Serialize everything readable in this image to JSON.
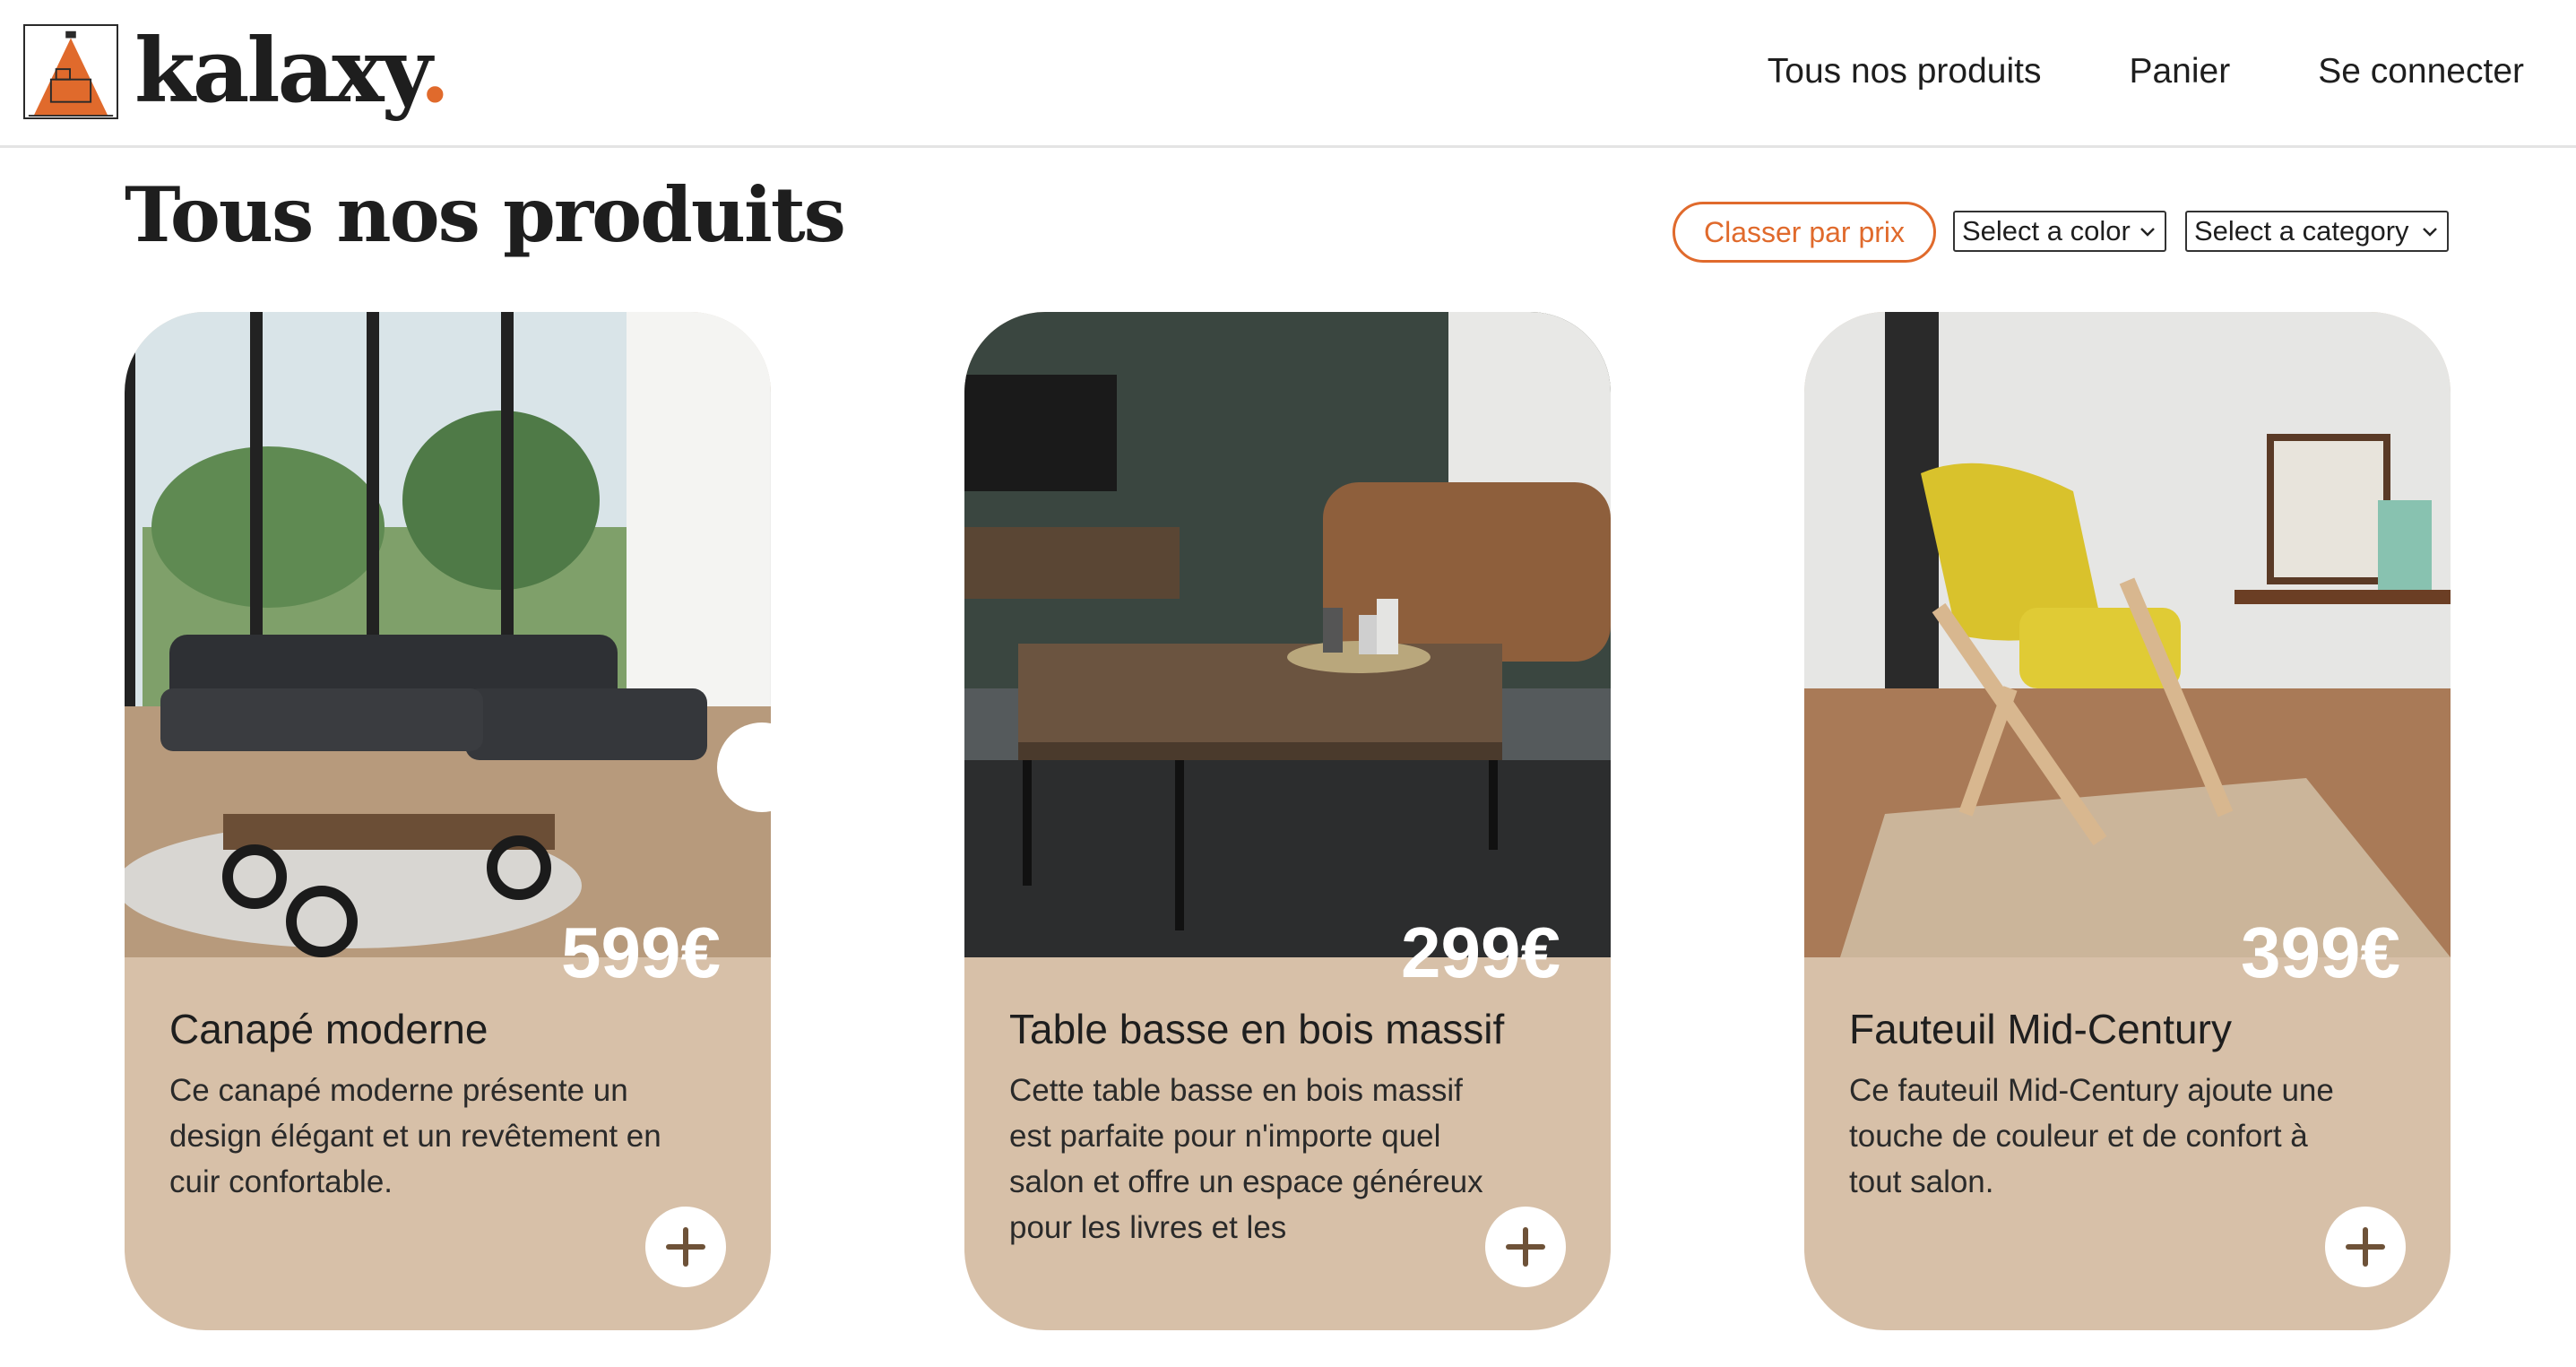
{
  "header": {
    "logo_text": "kalaxy",
    "logo_dot": ".",
    "nav": [
      {
        "label": "Tous nos produits"
      },
      {
        "label": "Panier"
      },
      {
        "label": "Se connecter"
      }
    ]
  },
  "page": {
    "title": "Tous nos produits",
    "sort_label": "Classer par prix",
    "color_select": "Select a color",
    "category_select": "Select a category"
  },
  "products": [
    {
      "price": "599€",
      "name": "Canapé moderne",
      "description": "Ce canapé moderne présente un design élégant et un revêtement en cuir confortable.",
      "image": "sofa-photo"
    },
    {
      "price": "299€",
      "name": "Table basse en bois massif",
      "description": "Cette table basse en bois massif est parfaite pour n'importe quel salon et offre un espace généreux pour les livres et les",
      "image": "coffee-table-photo"
    },
    {
      "price": "399€",
      "name": "Fauteuil Mid-Century",
      "description": "Ce fauteuil Mid-Century ajoute une touche de couleur et de confort à tout salon.",
      "image": "armchair-photo"
    }
  ],
  "colors": {
    "accent": "#e06a2c",
    "card_bg": "#d7c0a8",
    "text": "#1e1e1e"
  },
  "icons": {
    "add": "plus-icon",
    "select": "chevron-down-icon"
  }
}
